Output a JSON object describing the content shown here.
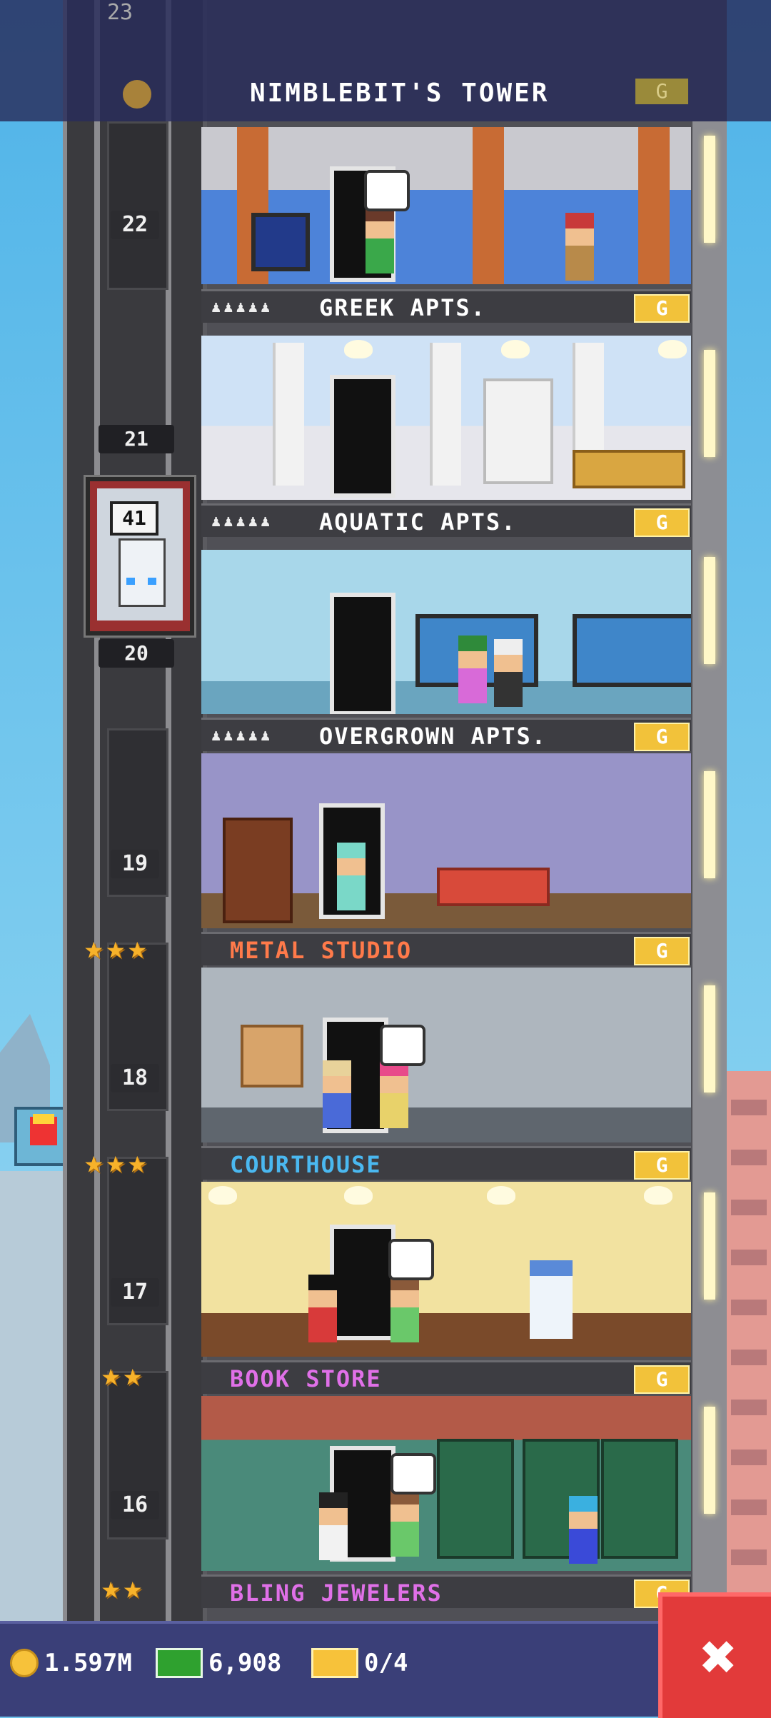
{
  "header": {
    "partial_floor_number": "23",
    "tower_name": "NIMBLEBIT'S TOWER",
    "gold_badge": "G"
  },
  "elevator": {
    "display": "41",
    "above_floor_partial": "21",
    "below_floor_partial": "20"
  },
  "floors": [
    {
      "number": "22",
      "name": "GREEK APTS.",
      "name_color": "#ffffff",
      "has_persons": true,
      "badge": "G"
    },
    {
      "number": "",
      "name": "AQUATIC APTS.",
      "name_color": "#ffffff",
      "has_persons": true,
      "badge": "G"
    },
    {
      "number": "20",
      "name": "OVERGROWN APTS.",
      "name_color": "#ffffff",
      "has_persons": true,
      "badge": "G"
    },
    {
      "number": "19",
      "name": "METAL STUDIO",
      "name_color": "#ff7a4a",
      "has_persons": false,
      "badge": "G",
      "stars": 3
    },
    {
      "number": "18",
      "name": "COURTHOUSE",
      "name_color": "#4ab8f0",
      "has_persons": false,
      "badge": "G",
      "stars": 3
    },
    {
      "number": "17",
      "name": "BOOK STORE",
      "name_color": "#e070e8",
      "has_persons": false,
      "badge": "G",
      "stars": 2
    },
    {
      "number": "16",
      "name": "BLING JEWELERS",
      "name_color": "#e070e8",
      "has_persons": false,
      "badge": "G",
      "stars": 2
    }
  ],
  "persons_icon": "♟♟♟♟♟",
  "star_glyph": "★",
  "bottom_bar": {
    "coins": "1.597M",
    "bux": "6,908",
    "tickets": "0/4",
    "close_label": "✖"
  }
}
